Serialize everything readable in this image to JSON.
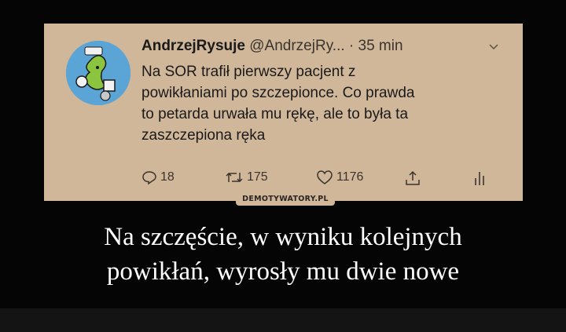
{
  "tweet": {
    "author_name": "AndrzejRysuje",
    "handle": "@AndrzejRy...",
    "time": "· 35 min",
    "lines": [
      "Na SOR trafił pierwszy pacjent z",
      "powikłaniami po szczepionce. Co prawda",
      "to petarda urwała mu rękę, ale to była ta",
      "zaszczepiona ręka"
    ],
    "actions": {
      "replies": "18",
      "retweets": "175",
      "likes": "1176"
    },
    "colors": {
      "card_bg": "#d1b79a",
      "avatar_bg": "#5aa4d6"
    }
  },
  "watermark": "DEMOTYWATORY.PL",
  "caption": {
    "line1": "Na szczęście, w wyniku kolejnych",
    "line2": "powikłań, wyrosły mu dwie nowe"
  }
}
